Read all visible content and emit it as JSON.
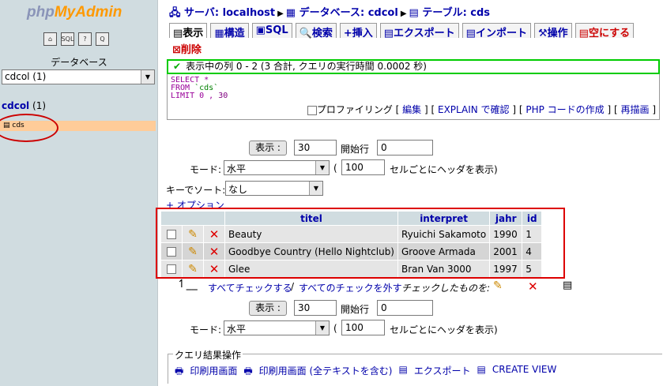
{
  "left": {
    "logo_a": "php",
    "logo_b": "MyAdmin",
    "icons": [
      "home-icon",
      "sql-icon",
      "help-icon",
      "query-icon"
    ],
    "db_label": "データベース",
    "db_select": "cdcol (1)",
    "db_name": "cdcol",
    "db_count": "(1)",
    "table_item": "cds"
  },
  "breadcrumb": {
    "server": "サーバ: localhost",
    "database": "データベース: cdcol",
    "table": "テーブル: cds"
  },
  "tabs": [
    "表示",
    "構造",
    "SQL",
    "検索",
    "挿入",
    "エクスポート",
    "インポート",
    "操作",
    "空にする"
  ],
  "delete_label": "削除",
  "notice": "表示中の列 0 - 2 (3 合計, クエリの実行時間 0.0002 秒)",
  "sql": {
    "l1": "SELECT *",
    "l2a": "FROM ",
    "l2b": "`cds`",
    "l3a": "LIMIT 0 , ",
    "l3b": "30"
  },
  "sql_links": {
    "profiling": "プロファイリング",
    "edit": "編集",
    "explain": "EXPLAIN で確認",
    "php": "PHP コードの作成",
    "refresh": "再描画"
  },
  "nav": {
    "show_btn": "表示 :",
    "rows": "30",
    "start_label": "開始行",
    "start": "0",
    "mode_label": "モード:",
    "mode": "水平",
    "headers_every": "100",
    "headers_label": "セルごとにヘッダを表示)",
    "paren": "("
  },
  "sort": {
    "label": "キーでソート:",
    "value": "なし",
    "options_link": "+ オプション"
  },
  "table": {
    "headers": [
      "titel",
      "interpret",
      "jahr",
      "id"
    ],
    "rows": [
      [
        "Beauty",
        "Ryuichi Sakamoto",
        "1990",
        "1"
      ],
      [
        "Goodbye Country (Hello Nightclub)",
        "Groove Armada",
        "2001",
        "4"
      ],
      [
        "Glee",
        "Bran Van 3000",
        "1997",
        "5"
      ]
    ]
  },
  "bulk": {
    "check_all": "すべてチェックする",
    "sep": "/",
    "uncheck_all": "すべてのチェックを外す",
    "with_selected": "チェックしたものを:"
  },
  "query_results": {
    "legend": "クエリ結果操作",
    "print": "印刷用画面",
    "print_full": "印刷用画面 (全テキストを含む)",
    "export": "エクスポート",
    "create_view": "CREATE VIEW"
  }
}
